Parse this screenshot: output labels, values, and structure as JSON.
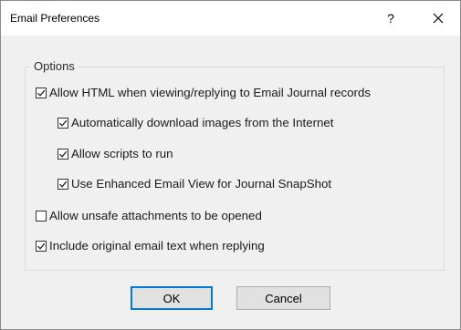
{
  "window": {
    "title": "Email Preferences",
    "help_label": "?"
  },
  "options": {
    "group_label": "Options",
    "items": [
      {
        "label": "Allow HTML when viewing/replying to Email Journal records",
        "checked": true
      },
      {
        "label": "Automatically download images from the Internet",
        "checked": true
      },
      {
        "label": "Allow scripts to run",
        "checked": true
      },
      {
        "label": "Use Enhanced Email View for Journal SnapShot",
        "checked": true
      },
      {
        "label": "Allow unsafe attachments to be opened",
        "checked": false
      },
      {
        "label": "Include original email text when replying",
        "checked": true
      }
    ]
  },
  "buttons": {
    "ok_label": "OK",
    "cancel_label": "Cancel"
  },
  "colors": {
    "focus_border": "#0078d7",
    "dialog_bg": "#f0f0f0"
  },
  "icons": {
    "help": "question-mark-icon",
    "close": "close-icon",
    "check": "checkmark-icon"
  }
}
